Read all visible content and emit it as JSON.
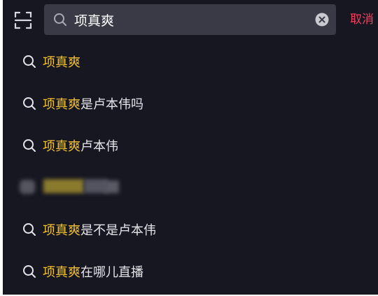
{
  "search": {
    "query": "项真爽",
    "cancel_label": "取消"
  },
  "suggestions": [
    {
      "highlight": "项真爽",
      "rest": ""
    },
    {
      "highlight": "项真爽",
      "rest": "是卢本伟吗"
    },
    {
      "highlight": "项真爽",
      "rest": "卢本伟"
    },
    {
      "highlight": "项真爽",
      "rest": "是不是卢本伟"
    },
    {
      "highlight": "项真爽",
      "rest": "在哪儿直播"
    }
  ],
  "colors": {
    "background": "#171722",
    "search_box": "#3a3a46",
    "highlight": "#f2c132",
    "text": "#e6e6ea",
    "cancel": "#f43f5e"
  },
  "icons": {
    "scan": "scan-icon",
    "search": "search-icon",
    "clear": "clear-icon"
  }
}
